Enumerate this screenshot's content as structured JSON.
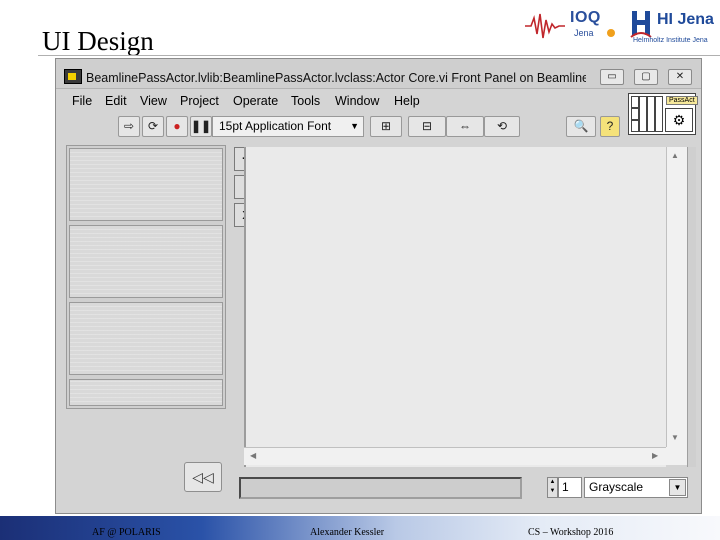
{
  "slide": {
    "title": "UI Design",
    "logos": {
      "ioq": "IOQ",
      "ioq_sub": "Jena",
      "hi": "HI Jena",
      "hi_sub": "Helmholtz Institute Jena"
    }
  },
  "window": {
    "title": "BeamlinePassActor.lvlib:BeamlinePassActor.lvclass:Actor Core.vi Front Panel on Beamline P...",
    "controls": {
      "minimize": "▭",
      "maximize": "▢",
      "close": "✕"
    },
    "menu": [
      "File",
      "Edit",
      "View",
      "Project",
      "Operate",
      "Tools",
      "Window",
      "Help"
    ],
    "toolbar": {
      "run_arrow": "⇨",
      "run_continuous": "⟳",
      "abort": "●",
      "pause": "❚❚",
      "font": "15pt Application Font",
      "align": "⊞",
      "distribute": "⊟",
      "resize": "⇔",
      "reorder": "⟲",
      "search": "🔍",
      "help": "?"
    },
    "connector_label": "PassAct",
    "side_buttons": [
      "+",
      "-",
      "x"
    ],
    "nav_back": "◁◁",
    "scroll_arrows": {
      "up": "▲",
      "down": "▼",
      "left": "◀",
      "right": "▶"
    },
    "status": {
      "zoom": "1",
      "palette_select": "Grayscale",
      "dropdown": "▼",
      "spin_up": "▲",
      "spin_down": "▼"
    }
  },
  "footer": {
    "left": "AF @ POLARIS",
    "center": "Alexander Kessler",
    "right": "CS – Workshop 2016"
  }
}
